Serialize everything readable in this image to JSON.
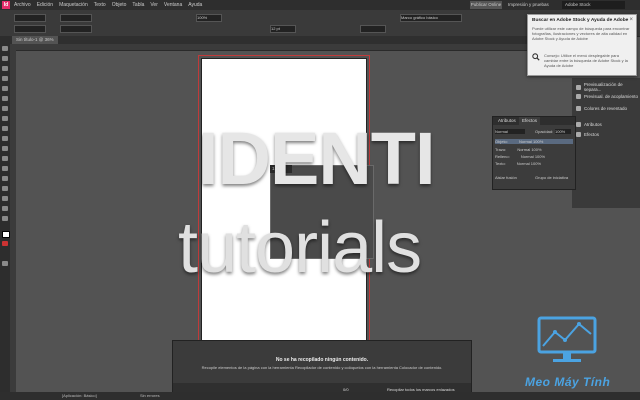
{
  "menubar": {
    "logo": "Id",
    "items": [
      "Archivo",
      "Edición",
      "Maquetación",
      "Texto",
      "Objeto",
      "Tabla",
      "Ver",
      "Ventana",
      "Ayuda"
    ],
    "publish_label": "Publicar Online",
    "workspace_label": "Impresión y pruebas",
    "search_placeholder": "Adobe Stock"
  },
  "control": {
    "zoom": "100%",
    "fontsize": "12 pt",
    "style_field": "Marco gráfico básico"
  },
  "document_tab": {
    "label": "Sin título-1 @ 36%"
  },
  "search_popup": {
    "title": "Buscar en Adobe Stock y Ayuda de Adobe",
    "description": "Puede utilizar este campo de búsqueda para encontrar fotografías, ilustraciones y vectores de alta calidad en Adobe Stock y Ayuda de Adobe",
    "tip": "Consejo: Utilice el menú desplegable para cambiar entre la búsqueda de Adobe Stock y la Ayuda de Adobe",
    "close": "×"
  },
  "right_panels": [
    {
      "label": "Previsualización de separa..."
    },
    {
      "label": "Previsual. de acoplamiento"
    },
    {
      "label": "Colores de reventado"
    },
    {
      "label": "Atributos"
    },
    {
      "label": "Efectos"
    }
  ],
  "effects_panel": {
    "tab1": "Atributos",
    "tab2": "Efectos",
    "mode": "Normal",
    "opacity_label": "Opacidad:",
    "opacity": "100%",
    "rows": [
      {
        "name": "Objeto:",
        "value": "Normal 100%"
      },
      {
        "name": "Trazo:",
        "value": "Normal 100%"
      },
      {
        "name": "Relleno:",
        "value": "Normal 100%"
      },
      {
        "name": "Texto:",
        "value": "Normal 100%"
      }
    ],
    "isolate": "Aislar fusión",
    "knockout": "Grupo de iniciativa"
  },
  "frame_label": "1",
  "watermark": {
    "line1": "IDENTI",
    "line2": "tutorials"
  },
  "content_collector": {
    "heading": "No se ha recopilado ningún contenido.",
    "subtext": "Recopile elementos de la página con la herramienta Recopilador de contenido y colóquelos con la herramienta Colocador de contenido.",
    "page_label": "0/0",
    "collect_label": "Recopilar todos los marcos enlazados"
  },
  "status": {
    "style": "[Aplicación: Básico]",
    "errors": "Sin errores"
  },
  "brand": {
    "text": "Meo Máy Tính",
    "color": "#4ba3e2"
  }
}
